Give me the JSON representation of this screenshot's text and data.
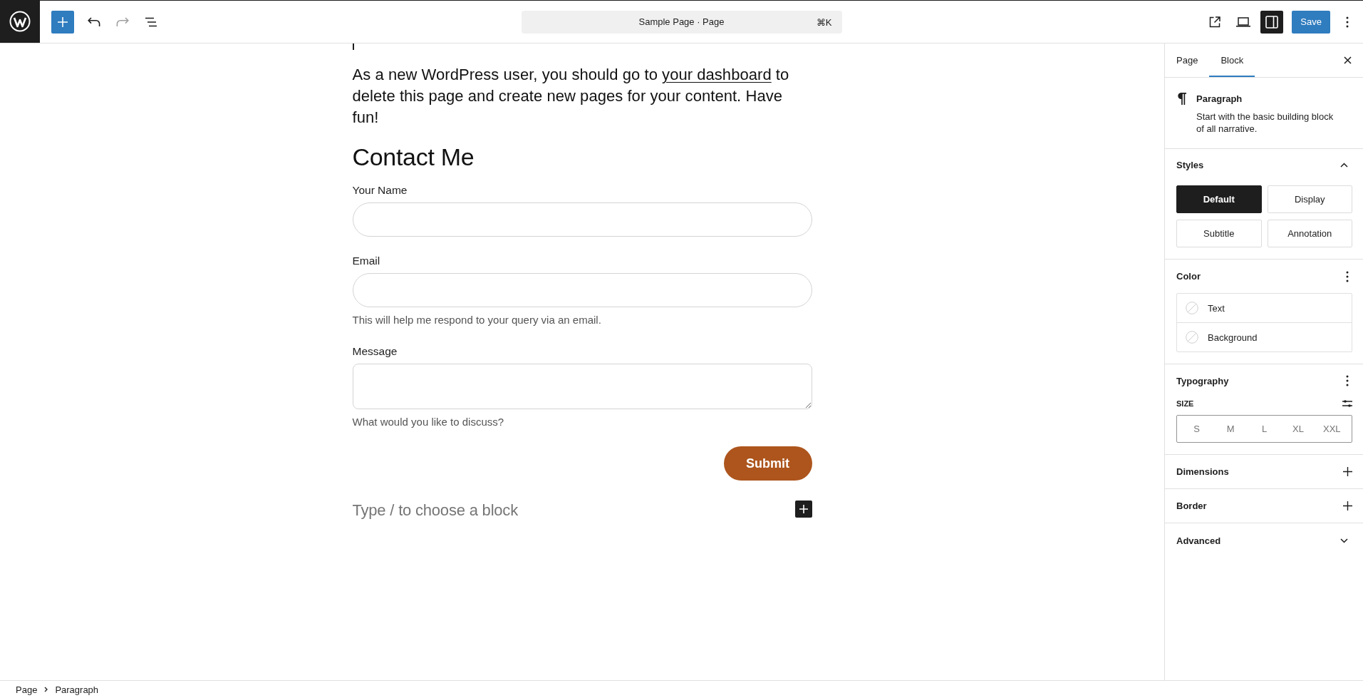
{
  "top_bar": {
    "toolbar": {
      "undo": {
        "disabled": false
      },
      "redo": {
        "disabled": true
      }
    },
    "command_bar": {
      "title": "Sample Page · Page",
      "shortcut": "⌘K"
    },
    "sidebar_toggle": {
      "pressed": true
    },
    "save_button": "Save"
  },
  "canvas": {
    "paragraph": {
      "before": "As a new WordPress user, you should go to",
      "link": "your dashboard",
      "after": "to delete this page and create new pages for your content. Have fun!"
    },
    "heading": "Contact Me",
    "form": {
      "fields": [
        {
          "kind": "input",
          "label": "Your Name"
        },
        {
          "kind": "input",
          "label": "Email",
          "help": "This will help me respond to your query via an email."
        },
        {
          "kind": "textarea",
          "label": "Message",
          "help": "What would you like to discuss?"
        }
      ],
      "submit": "Submit"
    },
    "prompt": "Type / to choose a block"
  },
  "sidebar": {
    "tabs": [
      {
        "label": "Page",
        "selected": false
      },
      {
        "label": "Block",
        "selected": true
      }
    ],
    "block_card": {
      "title": "Paragraph",
      "description": "Start with the basic building block of all narrative."
    },
    "panels": [
      {
        "kind": "styles",
        "title": "Styles",
        "expanded": true,
        "options": [
          {
            "label": "Default",
            "selected": true
          },
          {
            "label": "Display",
            "selected": false
          },
          {
            "label": "Subtitle",
            "selected": false
          },
          {
            "label": "Annotation",
            "selected": false
          }
        ]
      },
      {
        "kind": "color",
        "title": "Color",
        "items": [
          "Text",
          "Background"
        ]
      },
      {
        "kind": "typography",
        "title": "Typography",
        "size_label": "SIZE",
        "sizes": [
          {
            "label": "S",
            "selected": false
          },
          {
            "label": "M",
            "selected": false
          },
          {
            "label": "L",
            "selected": false
          },
          {
            "label": "XL",
            "selected": false
          },
          {
            "label": "XXL",
            "selected": false
          }
        ]
      },
      {
        "kind": "tools",
        "title": "Dimensions"
      },
      {
        "kind": "tools",
        "title": "Border"
      },
      {
        "kind": "toggle",
        "title": "Advanced",
        "expanded": false
      }
    ]
  },
  "breadcrumb": [
    "Page",
    "Paragraph"
  ]
}
